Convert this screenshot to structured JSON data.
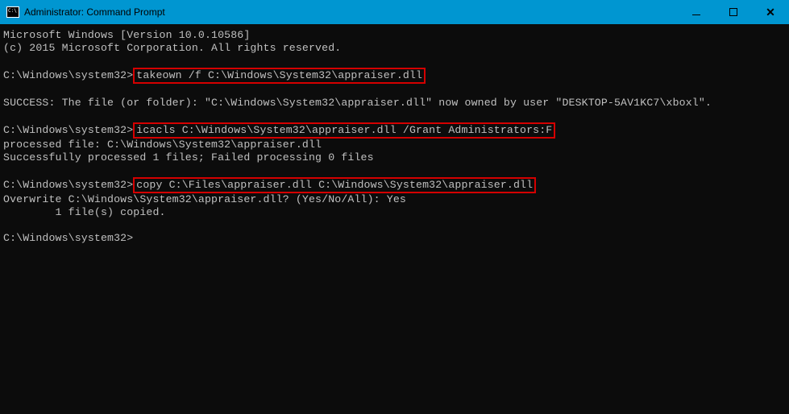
{
  "titlebar": {
    "title": "Administrator: Command Prompt"
  },
  "terminal": {
    "version_line": "Microsoft Windows [Version 10.0.10586]",
    "copyright_line": "(c) 2015 Microsoft Corporation. All rights reserved.",
    "prompt1": "C:\\Windows\\system32>",
    "cmd1": "takeown /f C:\\Windows\\System32\\appraiser.dll",
    "out1": "SUCCESS: The file (or folder): \"C:\\Windows\\System32\\appraiser.dll\" now owned by user \"DESKTOP-5AV1KC7\\xboxl\".",
    "prompt2": "C:\\Windows\\system32>",
    "cmd2": "icacls C:\\Windows\\System32\\appraiser.dll /Grant Administrators:F",
    "out2a": "processed file: C:\\Windows\\System32\\appraiser.dll",
    "out2b": "Successfully processed 1 files; Failed processing 0 files",
    "prompt3": "C:\\Windows\\system32>",
    "cmd3": "copy C:\\Files\\appraiser.dll C:\\Windows\\System32\\appraiser.dll",
    "out3a": "Overwrite C:\\Windows\\System32\\appraiser.dll? (Yes/No/All): Yes",
    "out3b": "        1 file(s) copied.",
    "prompt4": "C:\\Windows\\system32>"
  }
}
